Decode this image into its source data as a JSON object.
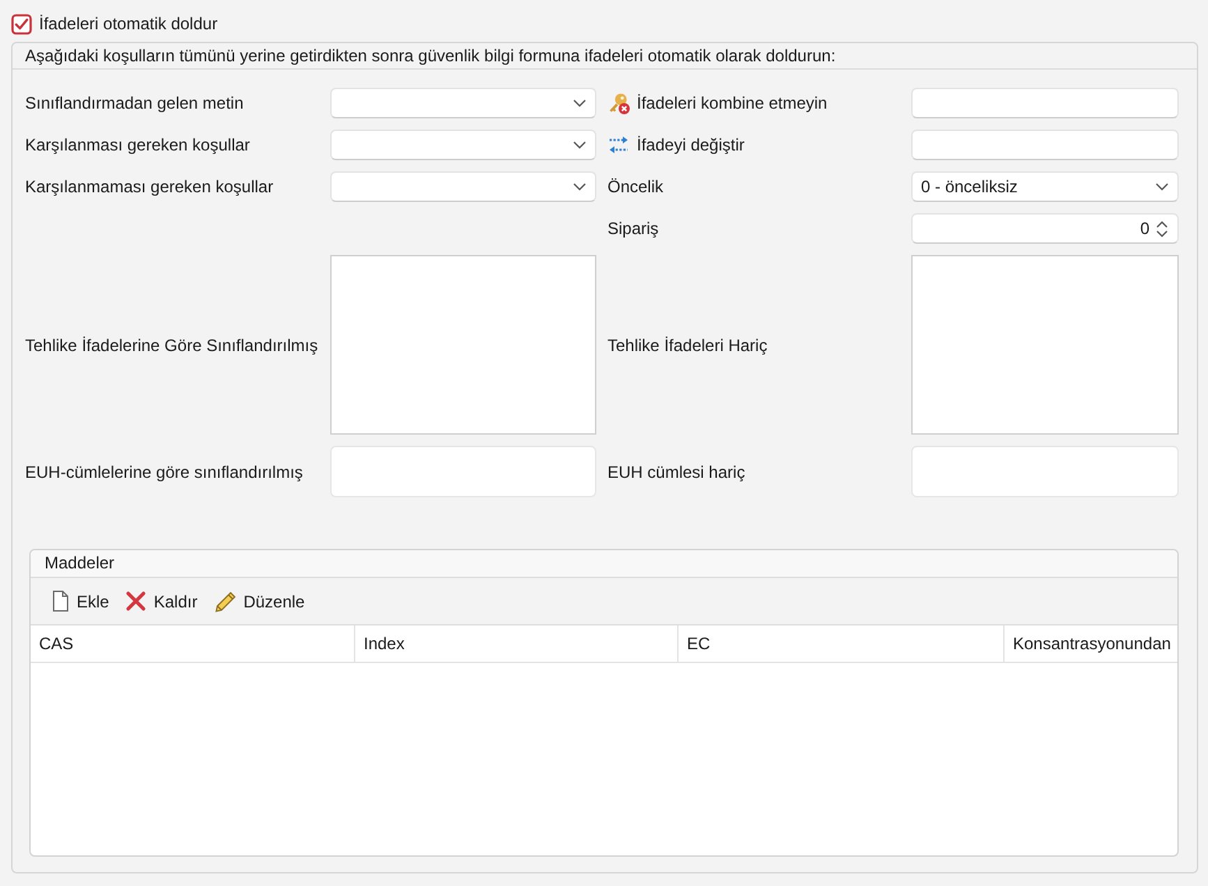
{
  "auto_fill": {
    "label": "İfadeleri otomatik doldur",
    "checked": true
  },
  "conditions": {
    "title": "Aşağıdaki koşulların tümünü yerine getirdikten sonra güvenlik bilgi formuna ifadeleri otomatik olarak doldurun:",
    "rows": [
      {
        "left": {
          "label": "Sınıflandırmadan gelen metin",
          "kind": "dropdown"
        },
        "right": {
          "label": "İfadeleri kombine etmeyin",
          "kind": "text"
        }
      },
      {
        "left": {
          "label": "Karşılanması gereken koşullar",
          "kind": "dropdown"
        },
        "right": {
          "label": "İfadeyi değiştir",
          "kind": "text"
        }
      },
      {
        "left": {
          "label": "Karşılanmaması gereken koşullar",
          "kind": "dropdown"
        },
        "right": {
          "label": "Öncelik",
          "kind": "dropdown",
          "value": "0 - önceliksiz"
        }
      },
      {
        "right": {
          "label": "Sipariş",
          "kind": "spinner",
          "value": "0"
        }
      },
      {
        "left": {
          "label": "Tehlike İfadelerine Göre Sınıflandırılmış",
          "kind": "list"
        },
        "right": {
          "label": "Tehlike İfadeleri Hariç",
          "kind": "list"
        }
      },
      {
        "left": {
          "label": "EUH-cümlelerine göre sınıflandırılmış",
          "kind": "memo"
        },
        "right": {
          "label": "EUH cümlesi hariç",
          "kind": "memo"
        }
      }
    ]
  },
  "substances": {
    "title": "Maddeler",
    "toolbar": [
      {
        "label": "Ekle",
        "kind": "add"
      },
      {
        "label": "Kaldır",
        "kind": "remove"
      },
      {
        "label": "Düzenle",
        "kind": "edit"
      }
    ],
    "table": {
      "columns": [
        "CAS",
        "Index",
        "EC",
        "Konsantrasyonundan"
      ]
    }
  }
}
